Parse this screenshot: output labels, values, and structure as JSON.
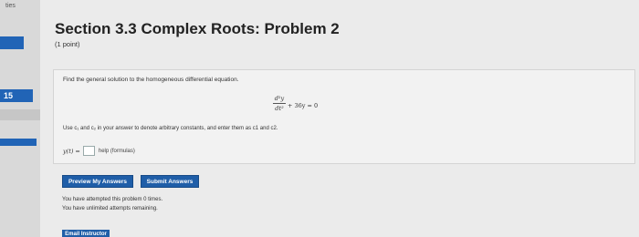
{
  "rail": {
    "top_text": "ties",
    "label": "15"
  },
  "problem": {
    "title": "Section 3.3 Complex Roots: Problem 2",
    "points": "(1 point)",
    "instructions": "Find the general solution to the homogeneous differential equation.",
    "equation": {
      "d2y_num": "d²y",
      "d2y_den": "dt²",
      "rest": "+ 36y = 0"
    },
    "usage_note": "Use c₁ and c₂ in your answer to denote arbitrary constants, and enter them as c1 and c2.",
    "answer_label": "y(t) =",
    "answer_value": "",
    "help_link": "help (formulas)"
  },
  "buttons": {
    "preview": "Preview My Answers",
    "submit": "Submit Answers",
    "email_instructor": "Email Instructor"
  },
  "status": {
    "attempted": "You have attempted this problem 0 times.",
    "remaining": "You have unlimited attempts remaining."
  },
  "colors": {
    "accent": "#2164b6",
    "button": "#1f5ea8",
    "background": "#ebebeb",
    "panel": "#f2f2f2"
  }
}
